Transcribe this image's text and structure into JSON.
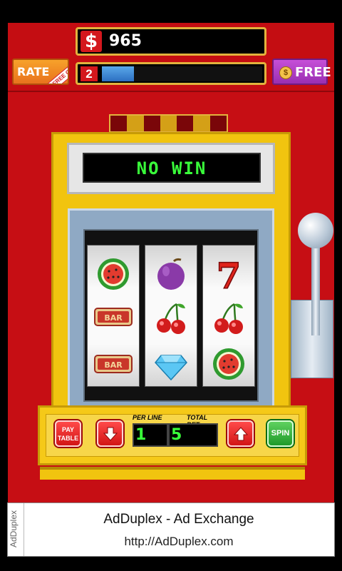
{
  "header": {
    "coin_symbol": "$",
    "coins": "965",
    "level": "2",
    "xp_progress": 0.2,
    "rate_label": "RATE",
    "rate_ribbon": "FREE COINS",
    "free_label": "FREE",
    "free_icon": "$"
  },
  "machine": {
    "message": "NO WIN",
    "reels": [
      [
        "watermelon",
        "bar",
        "bar"
      ],
      [
        "plum",
        "cherries",
        "diamond"
      ],
      [
        "seven",
        "cherries",
        "watermelon"
      ]
    ],
    "bar_text": "BAR",
    "seven_text": "7",
    "light_colors": [
      "#7a0609",
      "#d4a017",
      "#7a0609",
      "#d4a017",
      "#7a0609",
      "#d4a017",
      "#7a0609"
    ]
  },
  "controls": {
    "paytable_label": "PAY TABLE",
    "per_line_label": "PER LINE",
    "total_bet_label": "TOTAL BET",
    "per_line_value": "1",
    "total_bet_value": "5",
    "spin_label": "SPIN"
  },
  "ad": {
    "side_label": "AdDuplex",
    "title": "AdDuplex - Ad Exchange",
    "url": "http://AdDuplex.com"
  },
  "colors": {
    "machine_red": "#c60e14",
    "cabinet_yellow": "#f1c40f",
    "display_green": "#39ff3a",
    "button_red": "#d21515",
    "button_green": "#1f9a2a",
    "free_purple": "#9a2fb1",
    "rate_orange": "#e8721d"
  }
}
